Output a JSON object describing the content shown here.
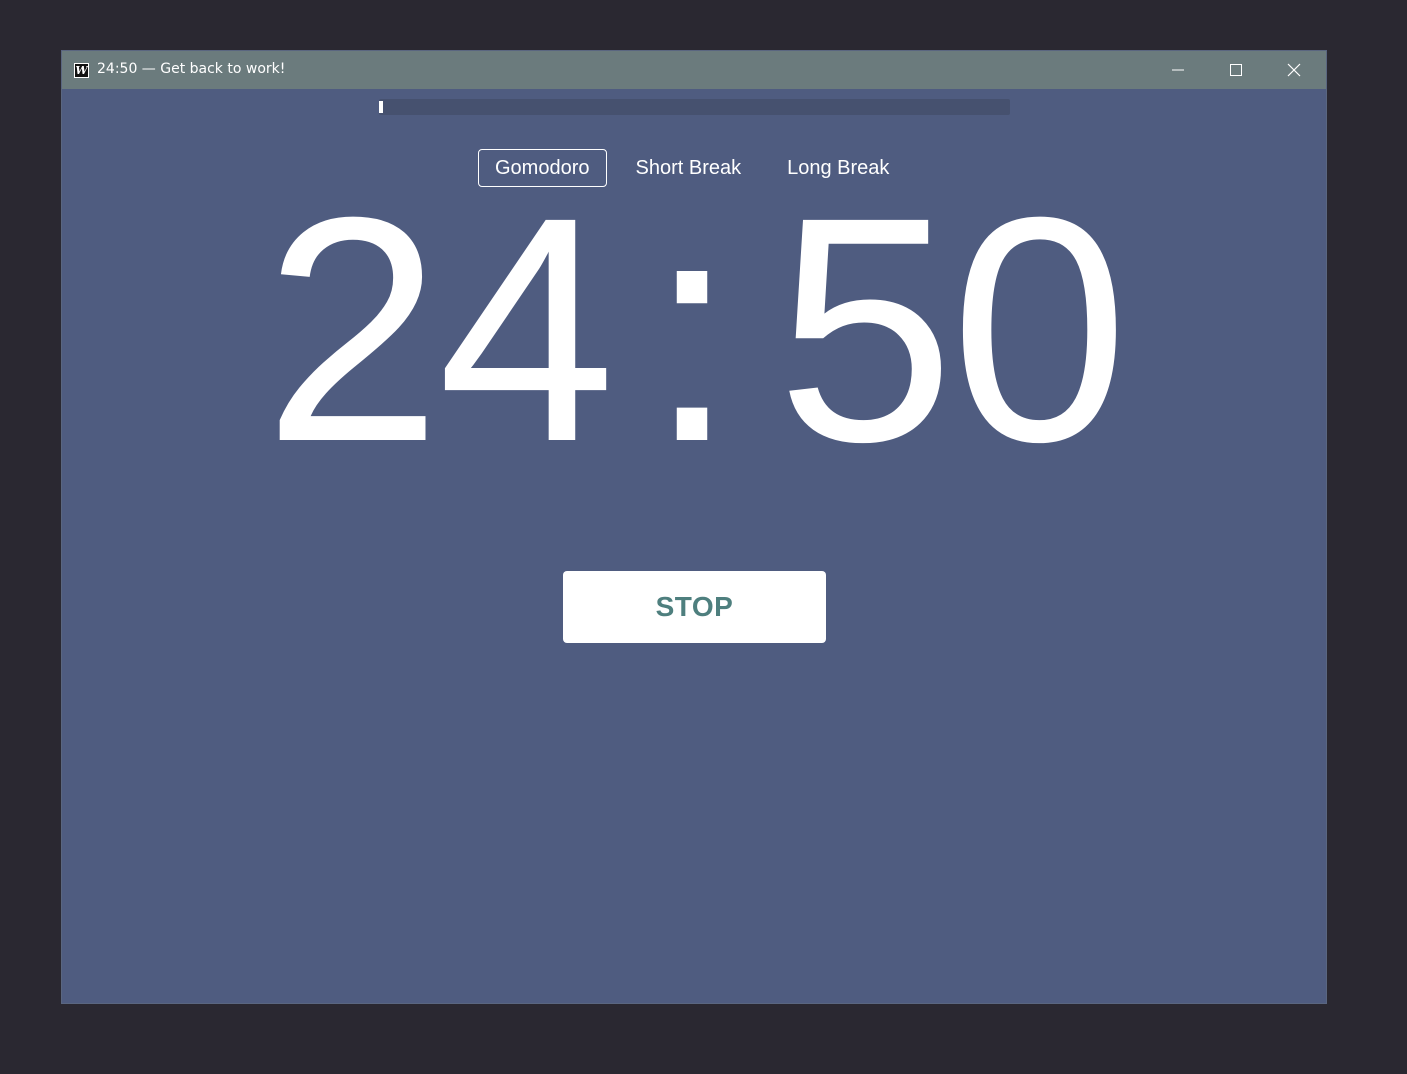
{
  "window": {
    "title": "24:50 — Get back to work!",
    "app_icon_letter": "W",
    "controls": [
      "minimize-icon",
      "maximize-icon",
      "close-icon"
    ]
  },
  "progress": {
    "fraction": 0.0067
  },
  "tabs": [
    {
      "label": "Gomodoro",
      "active": true
    },
    {
      "label": "Short Break",
      "active": false
    },
    {
      "label": "Long Break",
      "active": false
    }
  ],
  "timer": {
    "minutes": "24",
    "separator": ":",
    "seconds": "50"
  },
  "actions": {
    "stop_label": "STOP"
  },
  "colors": {
    "background": "#4f5c80",
    "titlebar": "#6b7b7d",
    "button_text": "#4e7f7e",
    "foreground": "#ffffff"
  }
}
